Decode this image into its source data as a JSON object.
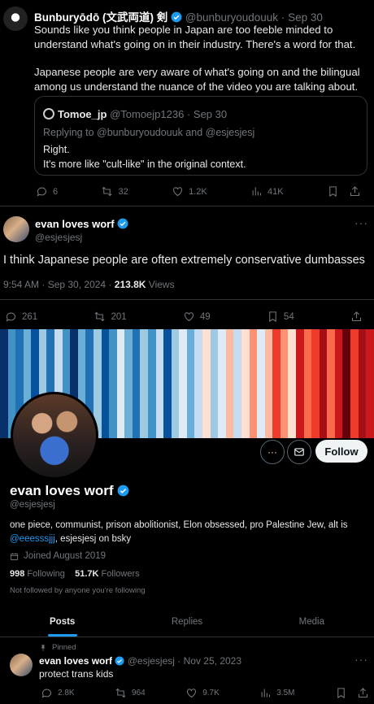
{
  "tweet1": {
    "name": "Bunburyōdō (文武両道) 剣",
    "handle": "@bunburyoudouuk",
    "date": "Sep 30",
    "paragraph1": "Sounds like you think people in Japan are too feeble minded to understand what's going on in their industry. There's a word for that.",
    "paragraph2": "Japanese people are very aware of what's going on and the bilingual among us understand the nuance of the video you are talking about.",
    "quote": {
      "name": "Tomoe_jp",
      "handle": "@Tomoejp1236",
      "date": "Sep 30",
      "replying_to": "Replying to @bunburyoudouuk and @esjesjesj",
      "line1": "Right.",
      "line2": "It's more like \"cult-like\" in the original context."
    },
    "stats": {
      "replies": "6",
      "reposts": "32",
      "likes": "1.2K",
      "views": "41K"
    }
  },
  "tweet2": {
    "name": "evan loves worf",
    "handle": "@esjesjesj",
    "text": "I think Japanese people are often extremely conservative dumbasses",
    "time": "9:54 AM · Sep 30, 2024 · ",
    "views_count": "213.8K",
    "views_label": " Views",
    "stats": {
      "replies": "261",
      "reposts": "201",
      "likes": "49",
      "bookmarks": "54"
    }
  },
  "banner": {
    "stripes": [
      "#08306b",
      "#4292c6",
      "#2171b5",
      "#6baed6",
      "#08519c",
      "#9ecae1",
      "#2171b5",
      "#c6dbef",
      "#4292c6",
      "#08306b",
      "#6baed6",
      "#2171b5",
      "#9ecae1",
      "#08519c",
      "#4292c6",
      "#deebf7",
      "#6baed6",
      "#2171b5",
      "#9ecae1",
      "#4292c6",
      "#c6dbef",
      "#08519c",
      "#9ecae1",
      "#deebf7",
      "#6baed6",
      "#c6dbef",
      "#fee0d2",
      "#9ecae1",
      "#deebf7",
      "#fcbba1",
      "#c6dbef",
      "#fee0d2",
      "#fc9272",
      "#deebf7",
      "#fcbba1",
      "#ef3b2c",
      "#fc9272",
      "#fee0d2",
      "#cb181d",
      "#fb6a4a",
      "#ef3b2c",
      "#a50f15",
      "#fb6a4a",
      "#cb181d",
      "#67000d",
      "#ef3b2c",
      "#a50f15",
      "#cb181d"
    ]
  },
  "profile": {
    "name": "evan loves worf",
    "handle": "@esjesjesj",
    "bio_prefix": "one piece, communist, prison abolitionist, Elon obsessed, pro Palestine Jew, alt is ",
    "bio_link": "@eeesssjjj",
    "bio_suffix": ", esjesjesj on bsky",
    "joined": "Joined August 2019",
    "following_count": "998",
    "following_label": " Following",
    "followers_count": "51.7K",
    "followers_label": " Followers",
    "not_followed": "Not followed by anyone you're following",
    "follow_label": "Follow",
    "more_label": "···"
  },
  "tabs": [
    "Posts",
    "Replies",
    "Media"
  ],
  "tweet3": {
    "pinned_label": "Pinned",
    "name": "evan loves worf",
    "handle": "@esjesjesj",
    "date": "Nov 25, 2023",
    "text": "protect trans kids",
    "stats": {
      "replies": "2.8K",
      "reposts": "964",
      "likes": "9.7K",
      "views": "3.5M"
    }
  },
  "colors": {
    "accent": "#1d9bf0",
    "muted": "#71767b",
    "background": "#000000"
  }
}
